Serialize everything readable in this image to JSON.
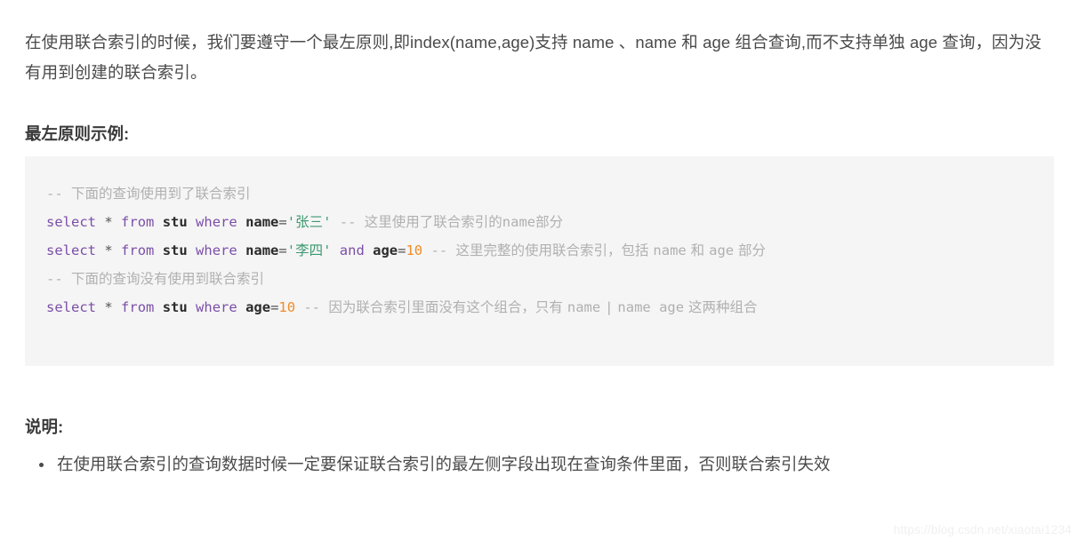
{
  "article": {
    "intro_paragraph": "在使用联合索引的时候，我们要遵守一个最左原则,即index(name,age)支持 name 、name 和 age 组合查询,而不支持单独 age 查询，因为没有用到创建的联合索引。",
    "heading_example": "最左原则示例:",
    "heading_note": "说明:",
    "notes": [
      "在使用联合索引的查询数据时候一定要保证联合索引的最左侧字段出现在查询条件里面，否则联合索引失效"
    ]
  },
  "code_block": {
    "language": "sql",
    "background_color": "#f5f5f5",
    "lines": [
      {
        "id": "line-1",
        "text": "-- 下面的查询使用到了联合索引",
        "tokens": [
          {
            "type": "comment",
            "text": "-- "
          },
          {
            "type": "comment_cjk",
            "text": "下面的查询使用到了联合索引"
          }
        ]
      },
      {
        "id": "line-2",
        "text": "select * from stu where name='张三' -- 这里使用了联合索引的name部分",
        "tokens": [
          {
            "type": "keyword",
            "text": "select"
          },
          {
            "type": "plain",
            "text": " "
          },
          {
            "type": "operator",
            "text": "*"
          },
          {
            "type": "plain",
            "text": " "
          },
          {
            "type": "keyword",
            "text": "from"
          },
          {
            "type": "plain",
            "text": " "
          },
          {
            "type": "identifier",
            "text": "stu"
          },
          {
            "type": "plain",
            "text": " "
          },
          {
            "type": "keyword",
            "text": "where"
          },
          {
            "type": "plain",
            "text": " "
          },
          {
            "type": "identifier",
            "text": "name"
          },
          {
            "type": "operator",
            "text": "="
          },
          {
            "type": "string",
            "text": "'"
          },
          {
            "type": "string_cjk",
            "text": "张三"
          },
          {
            "type": "string",
            "text": "'"
          },
          {
            "type": "plain",
            "text": " "
          },
          {
            "type": "comment",
            "text": "-- "
          },
          {
            "type": "comment_cjk",
            "text": "这里使用了联合索引的"
          },
          {
            "type": "comment",
            "text": "name"
          },
          {
            "type": "comment_cjk",
            "text": "部分"
          }
        ]
      },
      {
        "id": "line-3",
        "text": "select * from stu where name='李四' and age=10 -- 这里完整的使用联合索引，包括 name 和 age 部分",
        "tokens": [
          {
            "type": "keyword",
            "text": "select"
          },
          {
            "type": "plain",
            "text": " "
          },
          {
            "type": "operator",
            "text": "*"
          },
          {
            "type": "plain",
            "text": " "
          },
          {
            "type": "keyword",
            "text": "from"
          },
          {
            "type": "plain",
            "text": " "
          },
          {
            "type": "identifier",
            "text": "stu"
          },
          {
            "type": "plain",
            "text": " "
          },
          {
            "type": "keyword",
            "text": "where"
          },
          {
            "type": "plain",
            "text": " "
          },
          {
            "type": "identifier",
            "text": "name"
          },
          {
            "type": "operator",
            "text": "="
          },
          {
            "type": "string",
            "text": "'"
          },
          {
            "type": "string_cjk",
            "text": "李四"
          },
          {
            "type": "string",
            "text": "'"
          },
          {
            "type": "plain",
            "text": " "
          },
          {
            "type": "keyword",
            "text": "and"
          },
          {
            "type": "plain",
            "text": " "
          },
          {
            "type": "identifier",
            "text": "age"
          },
          {
            "type": "operator",
            "text": "="
          },
          {
            "type": "number",
            "text": "10"
          },
          {
            "type": "plain",
            "text": " "
          },
          {
            "type": "comment",
            "text": "-- "
          },
          {
            "type": "comment_cjk",
            "text": "这里完整的使用联合索引，包括 "
          },
          {
            "type": "comment",
            "text": "name"
          },
          {
            "type": "comment_cjk",
            "text": " 和 "
          },
          {
            "type": "comment",
            "text": "age"
          },
          {
            "type": "comment_cjk",
            "text": " 部分"
          }
        ]
      },
      {
        "id": "line-4",
        "text": "-- 下面的查询没有使用到联合索引",
        "tokens": [
          {
            "type": "comment",
            "text": "-- "
          },
          {
            "type": "comment_cjk",
            "text": "下面的查询没有使用到联合索引"
          }
        ]
      },
      {
        "id": "line-5",
        "text": "select * from stu where age=10 -- 因为联合索引里面没有这个组合，只有 name | name age 这两种组合",
        "tokens": [
          {
            "type": "keyword",
            "text": "select"
          },
          {
            "type": "plain",
            "text": " "
          },
          {
            "type": "operator",
            "text": "*"
          },
          {
            "type": "plain",
            "text": " "
          },
          {
            "type": "keyword",
            "text": "from"
          },
          {
            "type": "plain",
            "text": " "
          },
          {
            "type": "identifier",
            "text": "stu"
          },
          {
            "type": "plain",
            "text": " "
          },
          {
            "type": "keyword",
            "text": "where"
          },
          {
            "type": "plain",
            "text": " "
          },
          {
            "type": "identifier",
            "text": "age"
          },
          {
            "type": "operator",
            "text": "="
          },
          {
            "type": "number",
            "text": "10"
          },
          {
            "type": "plain",
            "text": " "
          },
          {
            "type": "comment",
            "text": "-- "
          },
          {
            "type": "comment_cjk",
            "text": "因为联合索引里面没有这个组合，只有 "
          },
          {
            "type": "comment",
            "text": "name"
          },
          {
            "type": "comment_cjk",
            "text": " "
          },
          {
            "type": "comment",
            "text": "|"
          },
          {
            "type": "comment_cjk",
            "text": " "
          },
          {
            "type": "comment",
            "text": "name age"
          },
          {
            "type": "comment_cjk",
            "text": " 这两种组合"
          }
        ]
      }
    ]
  },
  "watermark": {
    "text": "https://blog.csdn.net/xiaotai1234"
  },
  "colors": {
    "text": "#4a4a4a",
    "heading": "#3a3a3a",
    "code_bg": "#f5f5f5",
    "keyword": "#7b4fa8",
    "string": "#3d9970",
    "number": "#f08c28",
    "comment": "#b0b0b0",
    "watermark": "#f0f0f0"
  }
}
